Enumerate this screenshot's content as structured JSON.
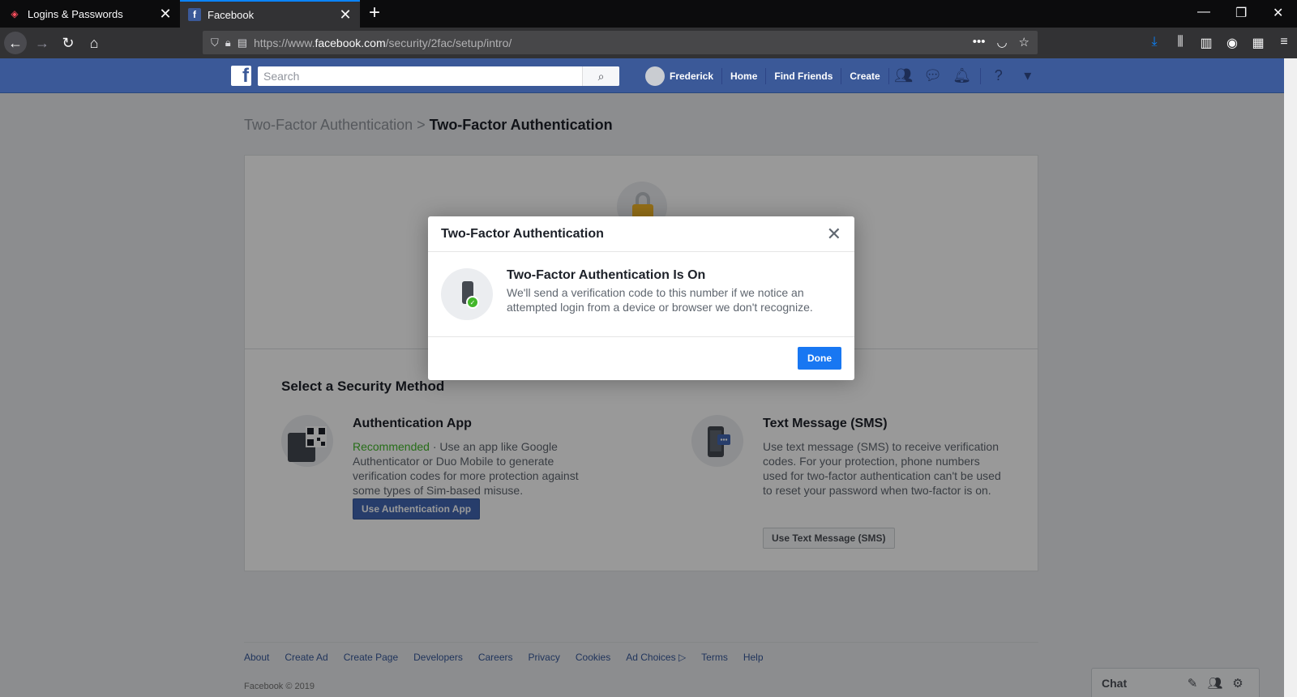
{
  "browser": {
    "tabs": [
      {
        "title": "Logins & Passwords",
        "icon": "lockwise-icon"
      },
      {
        "title": "Facebook",
        "icon": "facebook-icon"
      }
    ],
    "url_prefix": "https://www.",
    "url_domain": "facebook.com",
    "url_path": "/security/2fac/setup/intro/"
  },
  "fb": {
    "logo": "f",
    "search_placeholder": "Search",
    "user": "Frederick",
    "nav": [
      "Home",
      "Find Friends",
      "Create"
    ]
  },
  "page": {
    "breadcrumb_parent": "Two-Factor Authentication",
    "breadcrumb_sep": ">",
    "breadcrumb_current": "Two-Factor Authentication",
    "section_title": "Select a Security Method",
    "auth_app": {
      "title": "Authentication App",
      "recommended": "Recommended",
      "sep": " · ",
      "desc": "Use an app like Google Authenticator or Duo Mobile to generate verification codes for more protection against some types of Sim-based misuse.",
      "button": "Use Authentication App"
    },
    "sms": {
      "title": "Text Message (SMS)",
      "desc": "Use text message (SMS) to receive verification codes. For your protection, phone numbers used for two-factor authentication can't be used to reset your password when two-factor is on.",
      "button": "Use Text Message (SMS)"
    }
  },
  "modal": {
    "title": "Two-Factor Authentication",
    "close": "✕",
    "heading": "Two-Factor Authentication Is On",
    "text": "We'll send a verification code to this number if we notice an attempted login from a device or browser we don't recognize.",
    "done": "Done"
  },
  "footer": {
    "links": [
      "About",
      "Create Ad",
      "Create Page",
      "Developers",
      "Careers",
      "Privacy",
      "Cookies",
      "Ad Choices",
      "Terms",
      "Help"
    ],
    "copyright": "Facebook © 2019"
  },
  "chat": {
    "label": "Chat"
  },
  "colors": {
    "fb_blue": "#3b5998",
    "done_blue": "#1877f2",
    "recommended_green": "#42b72a"
  }
}
